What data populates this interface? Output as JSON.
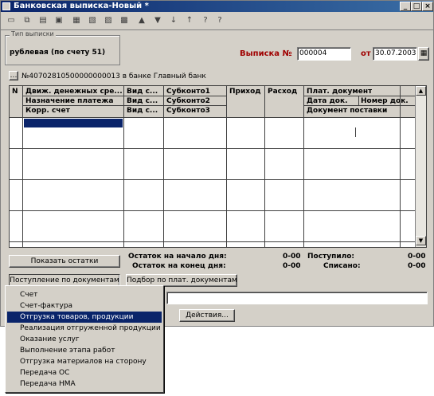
{
  "window": {
    "title": "Банковская выписка-Новый *"
  },
  "toolbar": {
    "icons": [
      "new-icon",
      "copy-icon",
      "folder-icon",
      "save-icon",
      "print-icon",
      "find-icon",
      "delete-icon",
      "insert-icon",
      "up-icon",
      "down-icon",
      "sort-asc-icon",
      "sort-desc-icon",
      "help-icon",
      "help-pointer-icon"
    ]
  },
  "type_group": {
    "legend": "Тип выписки",
    "value": "рублевая (по счету 51)"
  },
  "statement": {
    "label": "Выписка №",
    "number": "000004",
    "date_label": "от",
    "date": "30.07.2003"
  },
  "account": {
    "text": "№40702810500000000013 в банке Главный банк"
  },
  "table": {
    "headers": {
      "c1": [
        "Движ. денежных сре...",
        "Назначение платежа",
        "Корр. счет"
      ],
      "c2": [
        "Вид с...",
        "Вид с...",
        "Вид с..."
      ],
      "c3": [
        "Субконто1",
        "Субконто2",
        "Субконто3"
      ],
      "c4": [
        "Приход"
      ],
      "c5": [
        "Расход"
      ],
      "c6": [
        "Плат. документ",
        "Дата док.",
        "Номер док.",
        "Документ поставки"
      ]
    }
  },
  "totals": {
    "start_label": "Остаток на начало дня:",
    "start_value": "0-00",
    "end_label": "Остаток на конец дня:",
    "end_value": "0-00",
    "income_label": "Поступило:",
    "income_value": "0-00",
    "writeoff_label": "Списано:",
    "writeoff_value": "0-00"
  },
  "buttons": {
    "show_balances": "Показать остатки",
    "by_documents": "Поступление по документам",
    "select_by_payment": "Подбор по плат. документам",
    "actions": "Действия..."
  },
  "menu": {
    "items": [
      "Счет",
      "Счет-фактура",
      "Отгрузка товаров, продукции",
      "Реализация отгруженной продукции",
      "Оказание услуг",
      "Выполнение этапа работ",
      "Отгрузка материалов на сторону",
      "Передача ОС",
      "Передача НМА"
    ],
    "selected": "Отгрузка товаров, продукции"
  }
}
